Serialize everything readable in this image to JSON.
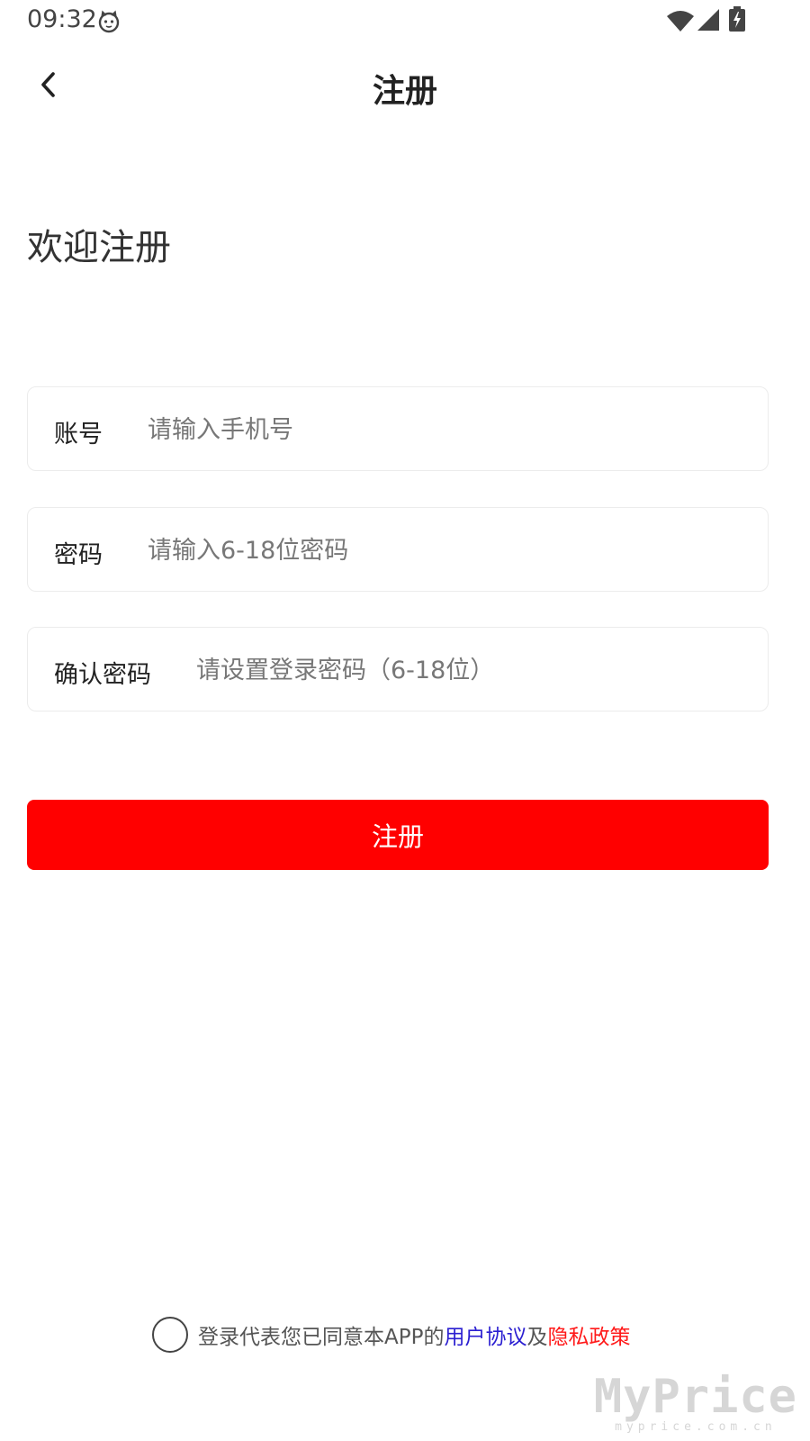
{
  "status_bar": {
    "time": "09:32"
  },
  "header": {
    "title": "注册"
  },
  "welcome": "欢迎注册",
  "form": {
    "account": {
      "label": "账号",
      "placeholder": "请输入手机号"
    },
    "password": {
      "label": "密码",
      "placeholder": "请输入6-18位密码"
    },
    "confirm": {
      "label": "确认密码",
      "placeholder": "请设置登录密码（6-18位）"
    }
  },
  "register_button": "注册",
  "agreement": {
    "prefix": "登录代表您已同意本APP的",
    "user_agreement": "用户协议",
    "and": "及",
    "privacy_policy": "隐私政策"
  },
  "watermark": {
    "logo": "MyPrice",
    "url": "myprice.com.cn"
  },
  "colors": {
    "accent": "#ff0000",
    "user_agreement_link": "#2b1fd1",
    "privacy_link": "#ff1a1a"
  },
  "icons": [
    "cat-icon",
    "wifi-icon",
    "signal-icon",
    "battery-charging-icon",
    "back-arrow-icon"
  ]
}
